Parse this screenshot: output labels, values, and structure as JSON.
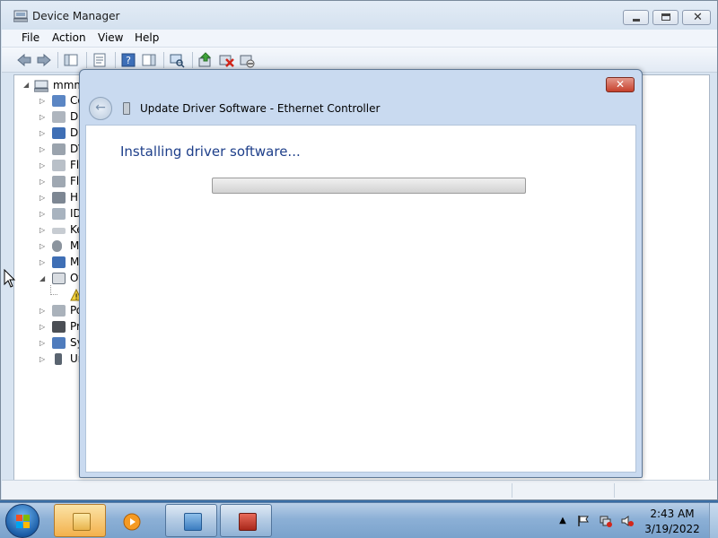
{
  "window": {
    "title": "Device Manager",
    "menu": [
      "File",
      "Action",
      "View",
      "Help"
    ]
  },
  "tree": {
    "root_label": "mmm",
    "items": [
      {
        "label": "Co",
        "expander": "▷",
        "icon": "monitor-icon"
      },
      {
        "label": "Di",
        "expander": "▷",
        "icon": "disk-drive-icon"
      },
      {
        "label": "Di",
        "expander": "▷",
        "icon": "display-adapter-icon"
      },
      {
        "label": "DV",
        "expander": "▷",
        "icon": "dvd-drive-icon"
      },
      {
        "label": "Fl",
        "expander": "▷",
        "icon": "floppy-drive-icon"
      },
      {
        "label": "Fl",
        "expander": "▷",
        "icon": "floppy-controller-icon"
      },
      {
        "label": "Hu",
        "expander": "▷",
        "icon": "hid-icon"
      },
      {
        "label": "ID",
        "expander": "▷",
        "icon": "ide-controller-icon"
      },
      {
        "label": "Ke",
        "expander": "▷",
        "icon": "keyboard-icon"
      },
      {
        "label": "Mi",
        "expander": "▷",
        "icon": "mouse-icon"
      },
      {
        "label": "Mo",
        "expander": "▷",
        "icon": "monitor-icon"
      },
      {
        "label": "Ot",
        "expander": "◢",
        "icon": "other-devices-icon"
      },
      {
        "label": "",
        "expander": "",
        "icon": "warning-device-icon"
      },
      {
        "label": "Po",
        "expander": "▷",
        "icon": "port-icon"
      },
      {
        "label": "Pr",
        "expander": "▷",
        "icon": "processor-icon"
      },
      {
        "label": "Sy",
        "expander": "▷",
        "icon": "system-device-icon"
      },
      {
        "label": "Ur",
        "expander": "▷",
        "icon": "usb-icon"
      }
    ]
  },
  "dialog": {
    "title": "Update Driver Software - Ethernet Controller",
    "heading": "Installing driver software...",
    "progress": 0
  },
  "taskbar": {
    "time": "2:43 AM",
    "date": "3/19/2022"
  }
}
